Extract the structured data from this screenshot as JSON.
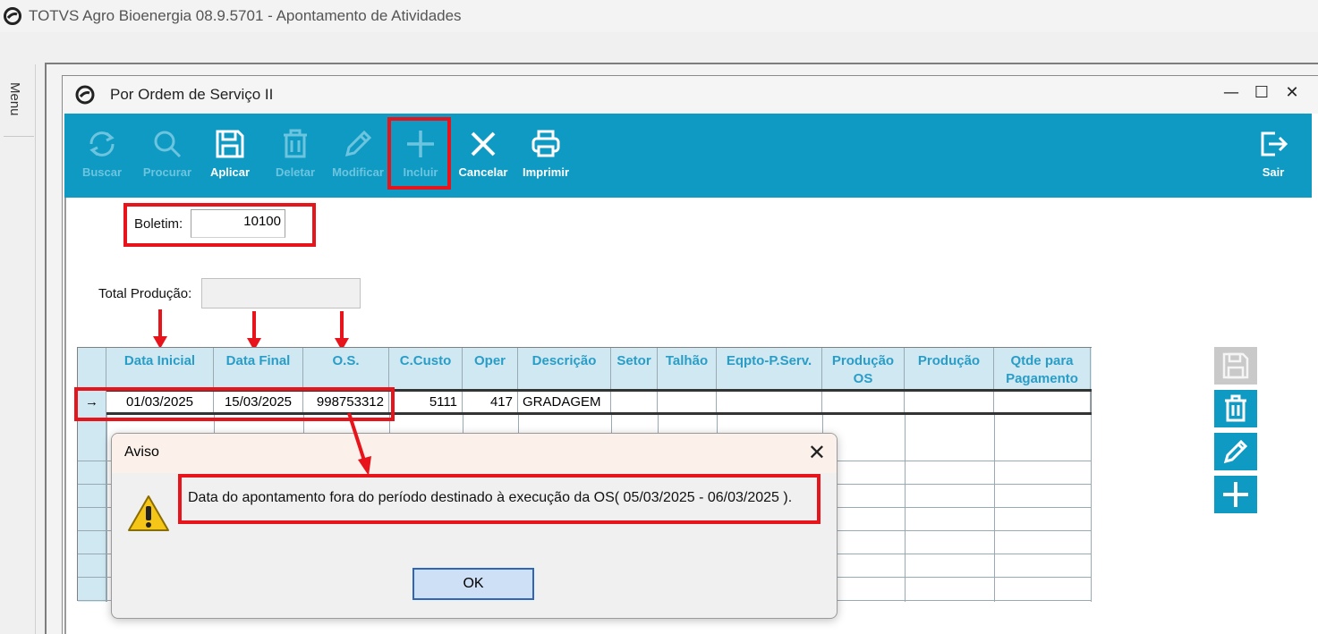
{
  "app": {
    "title": "TOTVS Agro Bioenergia 08.9.5701 - Apontamento de Atividades",
    "menu_label": "Menu"
  },
  "window": {
    "title": "Por Ordem de Serviço II",
    "minimize": "—",
    "maximize": "☐",
    "close": "✕"
  },
  "toolbar": {
    "buttons": [
      {
        "label": "Buscar",
        "icon": "refresh-icon",
        "enabled": false
      },
      {
        "label": "Procurar",
        "icon": "search-icon",
        "enabled": false
      },
      {
        "label": "Aplicar",
        "icon": "save-icon",
        "enabled": true
      },
      {
        "label": "Deletar",
        "icon": "trash-icon",
        "enabled": false
      },
      {
        "label": "Modificar",
        "icon": "pencil-icon",
        "enabled": false
      },
      {
        "label": "Incluir",
        "icon": "plus-icon",
        "enabled": false
      },
      {
        "label": "Cancelar",
        "icon": "x-icon",
        "enabled": true
      },
      {
        "label": "Imprimir",
        "icon": "printer-icon",
        "enabled": true
      }
    ],
    "exit_label": "Sair"
  },
  "form": {
    "boletim_label": "Boletim:",
    "boletim_value": "10100",
    "total_producao_label": "Total Produção:",
    "total_producao_value": ""
  },
  "grid": {
    "columns": [
      {
        "label": "Data Inicial"
      },
      {
        "label": "Data Final"
      },
      {
        "label": "O.S."
      },
      {
        "label": "C.Custo"
      },
      {
        "label": "Oper"
      },
      {
        "label": "Descrição"
      },
      {
        "label": "Setor"
      },
      {
        "label": "Talhão"
      },
      {
        "label": "Eqpto-P.Serv."
      },
      {
        "label": "Produção OS"
      },
      {
        "label": "Produção"
      },
      {
        "label": "Qtde para Pagamento"
      }
    ],
    "current_row_marker": "→",
    "rows": [
      [
        "01/03/2025",
        "15/03/2025",
        "998753312",
        "5111",
        "417",
        "GRADAGEM",
        "",
        "",
        "",
        "",
        "",
        ""
      ]
    ]
  },
  "dialog": {
    "title": "Aviso",
    "close": "✕",
    "message": "Data do apontamento fora do período destinado à execução da OS( 05/03/2025 - 06/03/2025 ).",
    "ok_label": "OK"
  },
  "colors": {
    "toolbar": "#0e9ac3",
    "highlight": "#e8141c",
    "grid_header": "#cfe8f2",
    "grid_header_text": "#2a9dc7"
  }
}
